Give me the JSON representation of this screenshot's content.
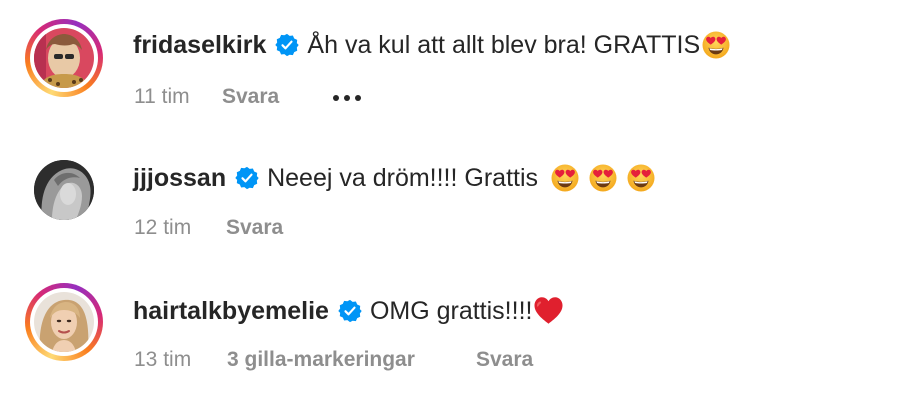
{
  "comments": [
    {
      "username": "fridaselkirk",
      "text": "Åh va kul att allt blev bra! GRATTIS",
      "emoji": [
        "heart-eyes"
      ],
      "time": "11 tim",
      "reply": "Svara",
      "has_story_ring": true
    },
    {
      "username": "jjjossan",
      "text": "Neeej va dröm!!!! Grattis",
      "emoji": [
        "heart-eyes",
        "heart-eyes",
        "heart-eyes"
      ],
      "time": "12 tim",
      "reply": "Svara",
      "has_story_ring": false
    },
    {
      "username": "hairtalkbyemelie",
      "text": "OMG grattis!!!!",
      "emoji": [
        "red-heart"
      ],
      "time": "13 tim",
      "likes": "3 gilla-markeringar",
      "reply": "Svara",
      "has_story_ring": true
    }
  ],
  "colors": {
    "verified_badge": "#0095f6",
    "secondary_text": "#8e8e8e",
    "primary_text": "#262626"
  },
  "icons": [
    "verified-badge-icon",
    "heart-eyes-emoji",
    "red-heart-emoji",
    "more-options-icon"
  ]
}
